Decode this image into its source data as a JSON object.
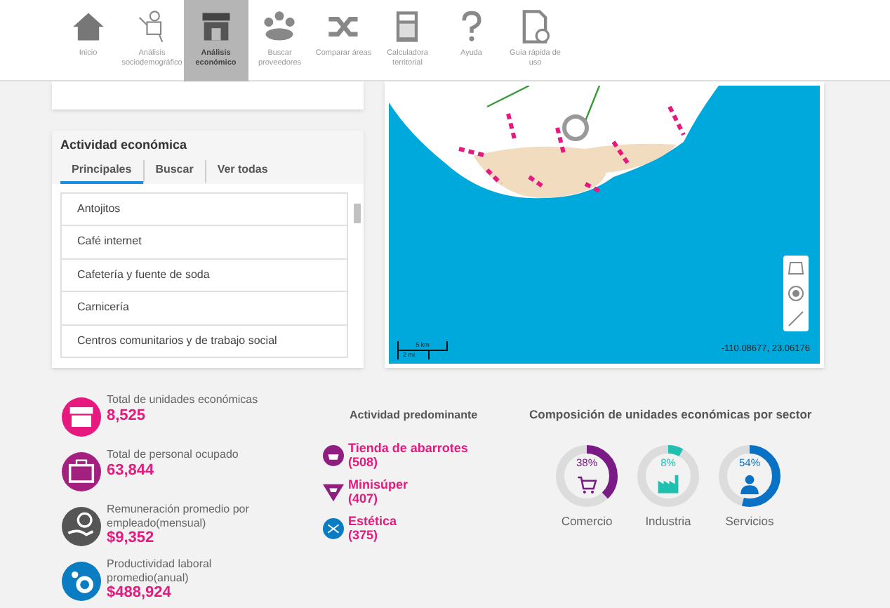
{
  "nav": [
    {
      "label": "Inicio",
      "kind": "home",
      "selected": false
    },
    {
      "label": "Análisis sociodemográfico",
      "kind": "person",
      "selected": false
    },
    {
      "label": "Análisis económico",
      "kind": "store",
      "selected": true
    },
    {
      "label": "Buscar proveedores",
      "kind": "group",
      "selected": false
    },
    {
      "label": "Comparar áreas",
      "kind": "shuffle",
      "selected": false
    },
    {
      "label": "Calculadora territorial",
      "kind": "calc",
      "selected": false
    },
    {
      "label": "Ayuda",
      "kind": "help",
      "selected": false
    },
    {
      "label": "Guía rápida de uso",
      "kind": "doc",
      "selected": false
    }
  ],
  "activity_panel": {
    "title": "Actividad económica",
    "tabs": [
      {
        "label": "Principales",
        "selected": true
      },
      {
        "label": "Buscar",
        "selected": false
      },
      {
        "label": "Ver todas",
        "selected": false
      }
    ],
    "items": [
      "Antojitos",
      "Café internet",
      "Cafetería y fuente de soda",
      "Carnicería",
      "Centros comunitarios y de trabajo social"
    ]
  },
  "map": {
    "scale_km": "5 km",
    "scale_mi": "2 mi",
    "coordinates": "-110.08677, 23.06176"
  },
  "stats": [
    {
      "label": "Total de unidades económicas",
      "value": "8,525",
      "kind": "store",
      "color": "#e6197e"
    },
    {
      "label": "Total de personal ocupado",
      "value": "63,844",
      "kind": "briefcase",
      "color": "#a3207f"
    },
    {
      "label": "Remuneración promedio por empleado(mensual)",
      "value": "$9,352",
      "kind": "money",
      "color": "#555555"
    },
    {
      "label": "Productividad laboral promedio(anual)",
      "value": "$488,924",
      "kind": "gears",
      "color": "#0a7cc2"
    }
  ],
  "predominant": {
    "title": "Actividad predominante",
    "items": [
      {
        "name": "Tienda de abarrotes",
        "count": "(508)",
        "kind": "basket",
        "color": "#8e1f7f"
      },
      {
        "name": "Minisúper",
        "count": "(407)",
        "kind": "triangle",
        "color": "#8e1f7f"
      },
      {
        "name": "Estética",
        "count": "(375)",
        "kind": "scissors",
        "color": "#0a7cc2"
      }
    ]
  },
  "composition": {
    "title": "Composición de unidades económicas por sector",
    "sectors": [
      {
        "name": "Comercio",
        "percent": "38%",
        "level": 0.38,
        "color": "#7a1a86",
        "kind": "cart"
      },
      {
        "name": "Industria",
        "percent": "8%",
        "level": 0.08,
        "color": "#20c0b0",
        "kind": "factory"
      },
      {
        "name": "Servicios",
        "percent": "54%",
        "level": 0.54,
        "color": "#0a72c4",
        "kind": "person"
      }
    ]
  }
}
